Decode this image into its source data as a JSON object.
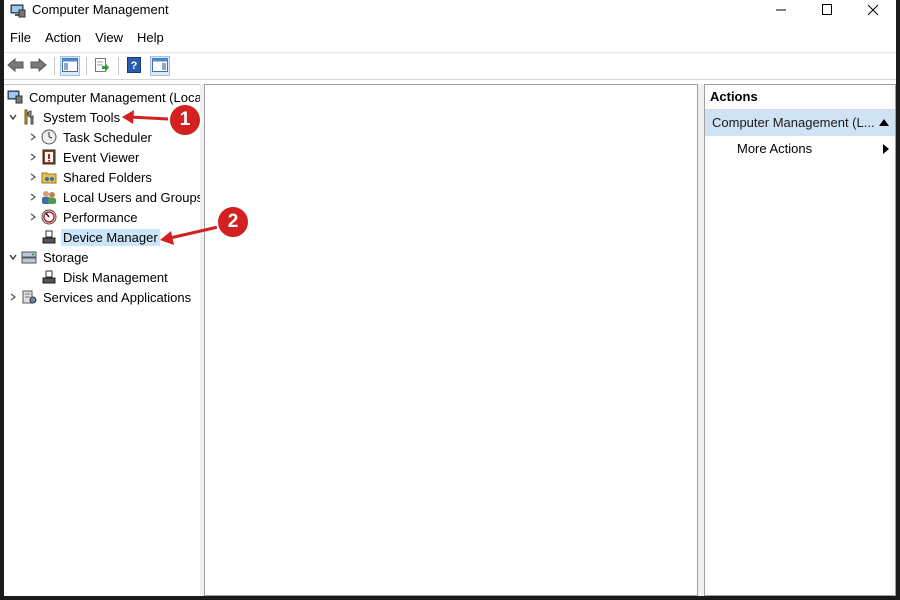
{
  "window": {
    "title": "Computer Management"
  },
  "menu": [
    "File",
    "Action",
    "View",
    "Help"
  ],
  "tree": {
    "root": "Computer Management (Local",
    "system_tools": "System Tools",
    "task_scheduler": "Task Scheduler",
    "event_viewer": "Event Viewer",
    "shared_folders": "Shared Folders",
    "local_users": "Local Users and Groups",
    "performance": "Performance",
    "device_manager": "Device Manager",
    "storage": "Storage",
    "disk_management": "Disk Management",
    "services": "Services and Applications"
  },
  "actions": {
    "header": "Actions",
    "section": "Computer Management (L...",
    "more": "More Actions"
  },
  "annotations": {
    "one": "1",
    "two": "2"
  },
  "colors": {
    "selection": "#cce4f7",
    "actions_section": "#cfe3f4",
    "callout": "#d32020"
  }
}
